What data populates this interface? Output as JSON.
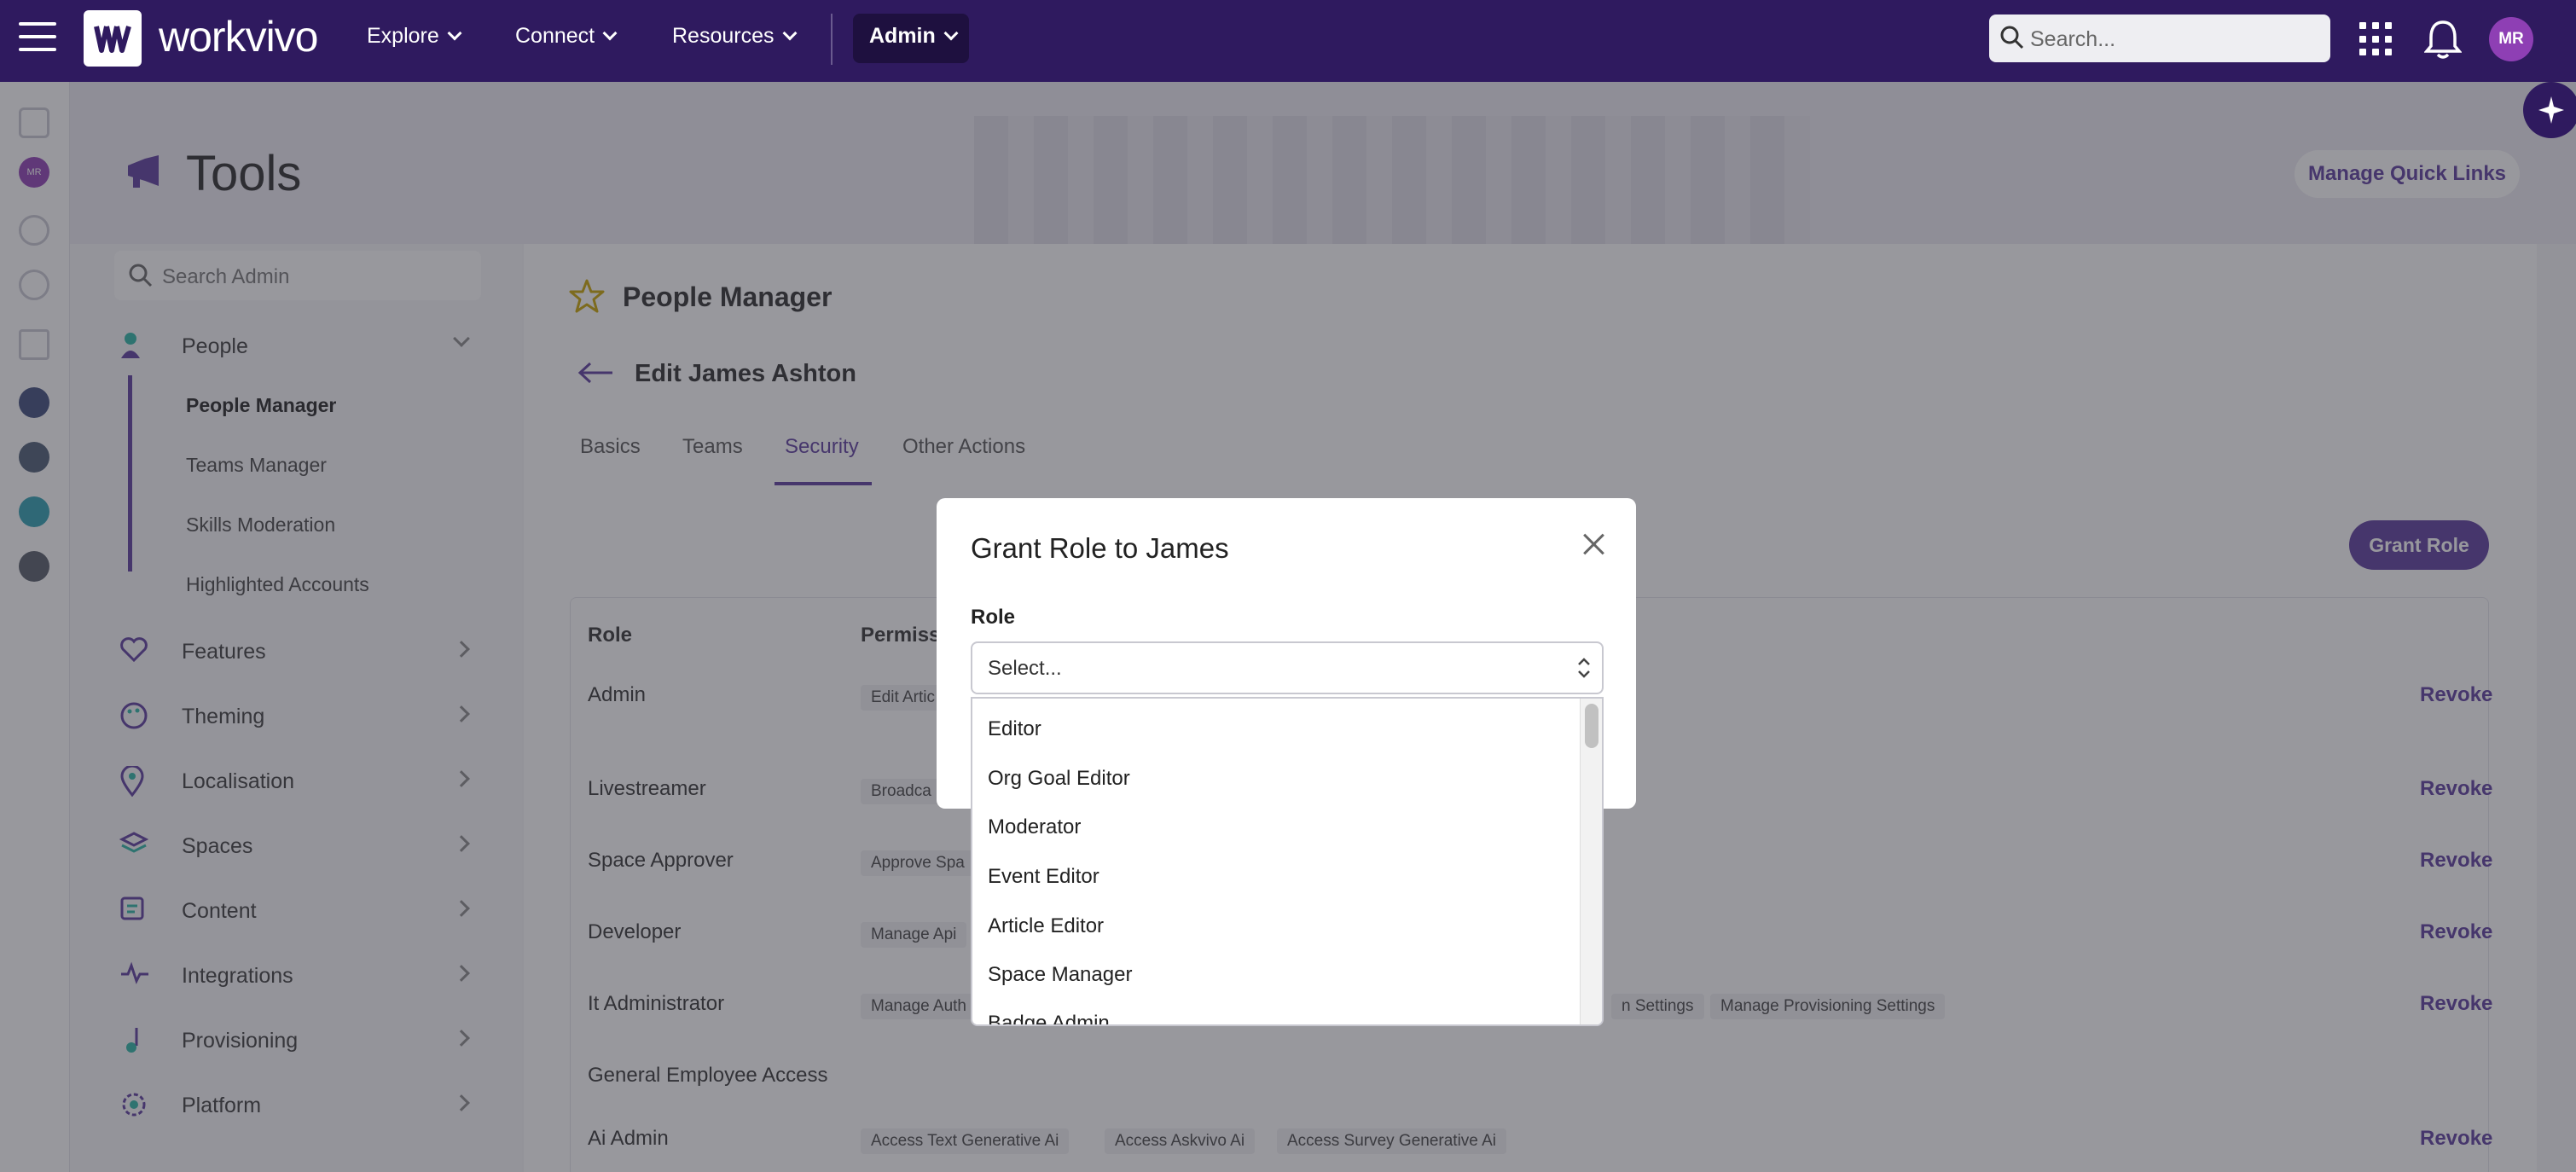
{
  "topnav": {
    "brand": "workvivo",
    "items": [
      {
        "label": "Explore"
      },
      {
        "label": "Connect"
      },
      {
        "label": "Resources"
      }
    ],
    "admin_label": "Admin",
    "search_placeholder": "Search...",
    "avatar_initials": "MR"
  },
  "rail": {
    "avatar_initials": "MR"
  },
  "header": {
    "title": "Tools",
    "quick_links_label": "Manage Quick Links"
  },
  "sidenav": {
    "search_placeholder": "Search Admin",
    "people_label": "People",
    "people_sub": [
      "People Manager",
      "Teams Manager",
      "Skills Moderation",
      "Highlighted Accounts"
    ],
    "sections": [
      "Features",
      "Theming",
      "Localisation",
      "Spaces",
      "Content",
      "Integrations",
      "Provisioning",
      "Platform"
    ]
  },
  "main": {
    "page_title": "People Manager",
    "edit_title": "Edit James Ashton",
    "tabs": [
      "Basics",
      "Teams",
      "Security",
      "Other Actions"
    ],
    "active_tab": "Security",
    "grant_role_button": "Grant Role",
    "table_headers": {
      "role": "Role",
      "permissions": "Permiss"
    },
    "revoke_label": "Revoke",
    "rows": [
      {
        "role": "Admin",
        "perms": [
          "Edit Artic"
        ]
      },
      {
        "role": "Livestreamer",
        "perms": [
          "Broadca"
        ]
      },
      {
        "role": "Space Approver",
        "perms": [
          "Approve Spa"
        ]
      },
      {
        "role": "Developer",
        "perms": [
          "Manage Api"
        ]
      },
      {
        "role": "It Administrator",
        "perms": [
          "Manage Auth",
          "n Settings",
          "Manage Provisioning Settings"
        ]
      },
      {
        "role": "General Employee Access",
        "perms": []
      },
      {
        "role": "Ai Admin",
        "perms": [
          "Access Text Generative Ai",
          "Access Askvivo Ai",
          "Access Survey Generative Ai"
        ]
      }
    ]
  },
  "modal": {
    "title": "Grant Role to James",
    "field_label": "Role",
    "select_placeholder": "Select...",
    "options": [
      "Editor",
      "Org Goal Editor",
      "Moderator",
      "Event Editor",
      "Article Editor",
      "Space Manager",
      "Badge Admin"
    ]
  },
  "colors": {
    "topbar": "#2f1a5f",
    "accent": "#5b3a9c",
    "avatar": "#8e3fb4"
  },
  "icons": [
    "menu-icon",
    "workvivo-logo-icon",
    "chevron-down-icon",
    "search-icon",
    "apps-grid-icon",
    "bell-icon",
    "ai-sparkle-icon",
    "megaphone-icon",
    "star-icon",
    "back-arrow-icon",
    "close-icon",
    "select-updown-icon"
  ]
}
